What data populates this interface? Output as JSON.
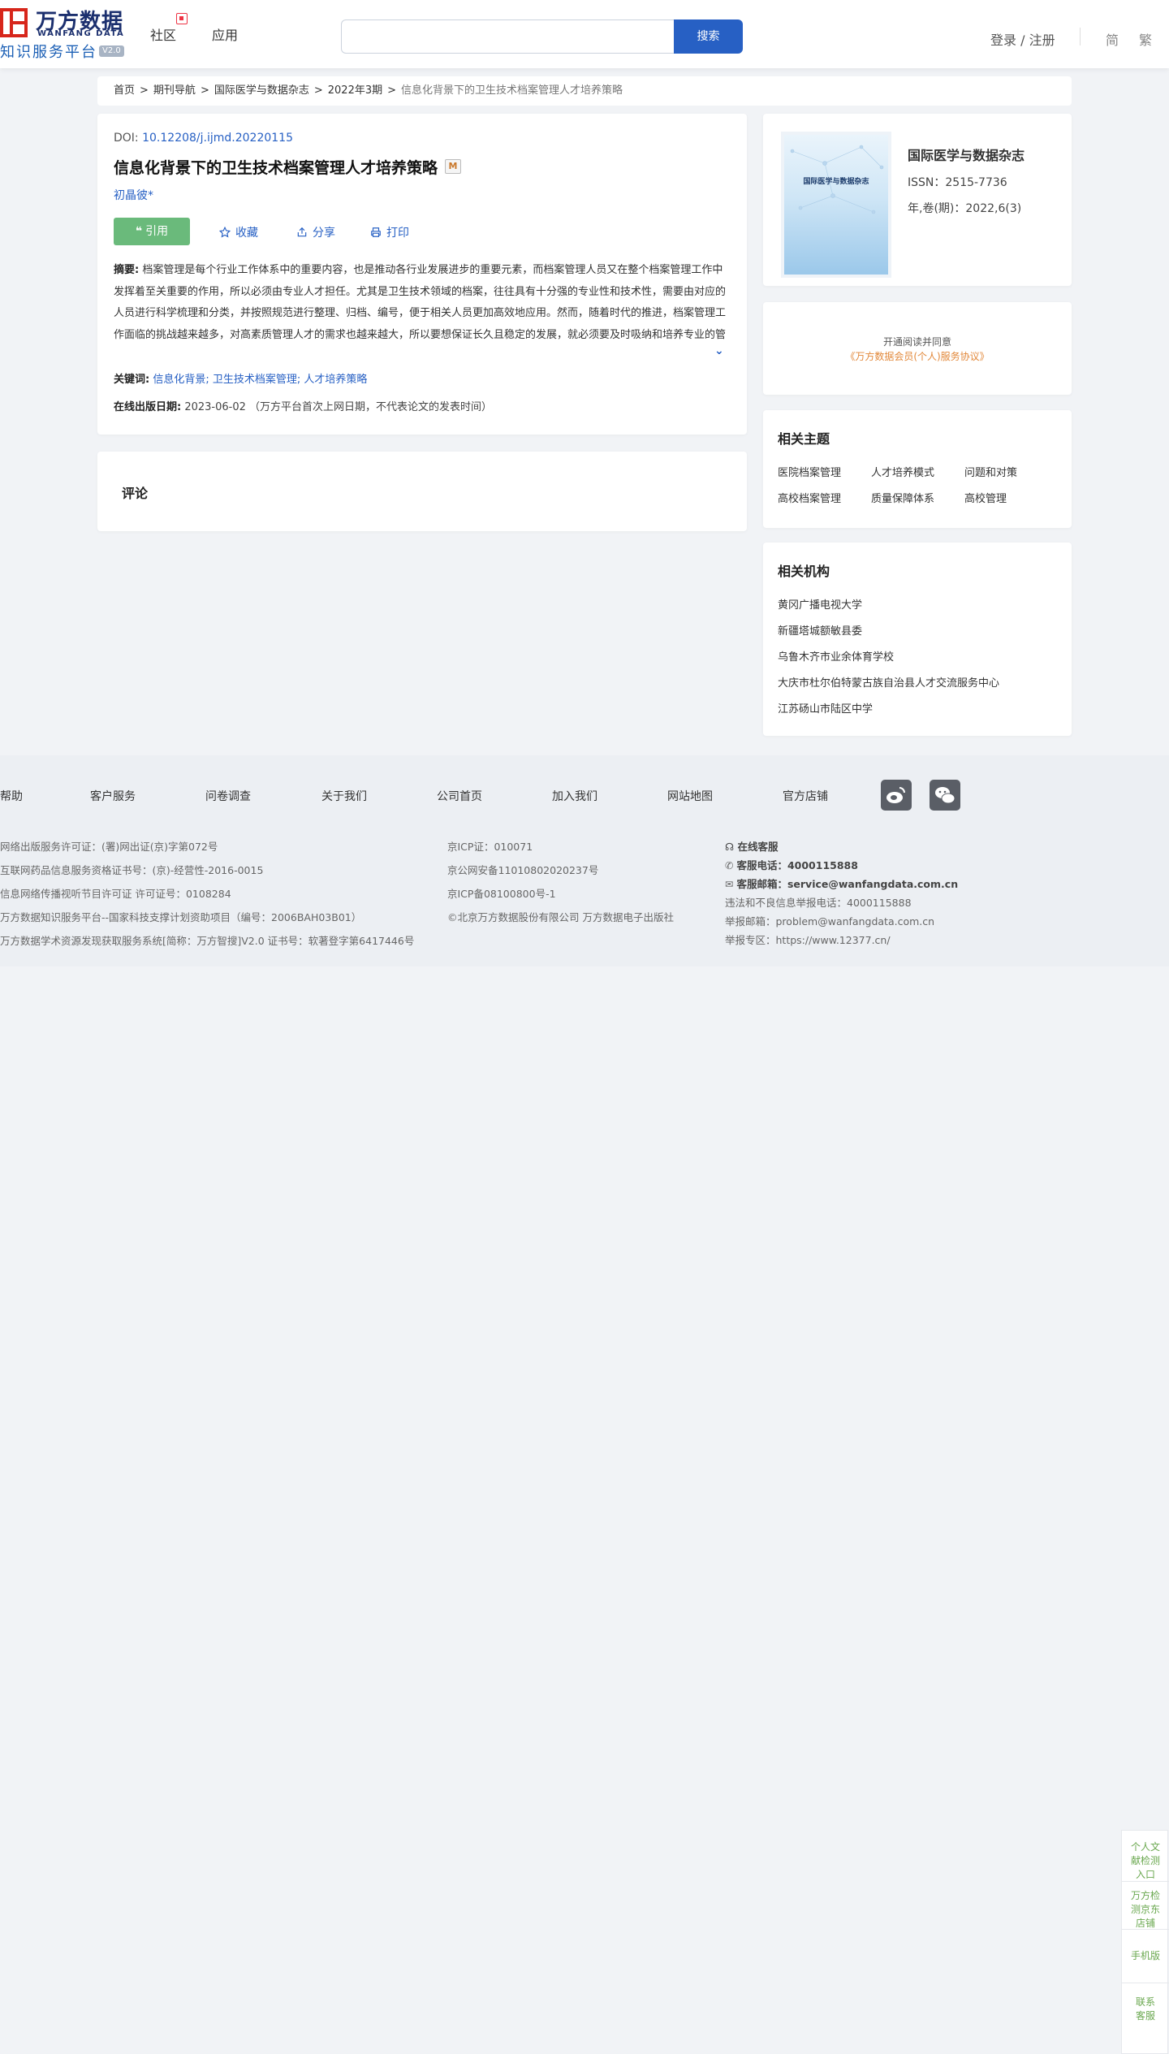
{
  "header": {
    "logo_cn": "万方数据",
    "logo_en": "WANFANG DATA",
    "platform": "知识服务平台",
    "version": "V2.0",
    "nav": [
      "社区",
      "应用"
    ],
    "search_placeholder": "",
    "search_button": "搜索",
    "login": "登录 / 注册",
    "lang_simplified": "简",
    "lang_traditional": "繁"
  },
  "breadcrumb": {
    "items": [
      "首页",
      "期刊导航",
      "国际医学与数据杂志",
      "2022年3期"
    ],
    "current": "信息化背景下的卫生技术档案管理人才培养策略",
    "separator": ">"
  },
  "article": {
    "doi_label": "DOI:",
    "doi": "10.12208/j.ijmd.20220115",
    "title": "信息化背景下的卫生技术档案管理人才培养策略",
    "badge": "M",
    "author": "初晶彼*",
    "cite_label": "引用",
    "actions": [
      "收藏",
      "分享",
      "打印"
    ],
    "abstract_label": "摘要:",
    "abstract": "档案管理是每个行业工作体系中的重要内容，也是推动各行业发展进步的重要元素，而档案管理人员又在整个档案管理工作中发挥着至关重要的作用，所以必须由专业人才担任。尤其是卫生技术领域的档案，往往具有十分强的专业性和技术性，需要由对应的人员进行科学梳理和分类，并按照规范进行整理、归档、编号，便于相关人员更加高效地应用。然而，随着时代的推进，档案管理工作面临的挑战越来越多，对高素质管理人才的需求也越来越大，所以要想保证长久且稳定的发展，就必须要及时吸纳和培养专业的管理人才，确保相关工作顺利推进。鉴于此，本文基于信息化背景，以卫生技术档...",
    "keywords_label": "关键词:",
    "keywords": [
      "信息化背景;",
      "卫生技术档案管理;",
      "人才培养策略"
    ],
    "pubdate_label": "在线出版日期:",
    "pubdate": "2023-06-02",
    "pubdate_note": "（万方平台首次上网日期，不代表论文的发表时间）"
  },
  "comment": {
    "title": "评论"
  },
  "journal": {
    "cover_title": "国际医学与数据杂志",
    "name": "国际医学与数据杂志",
    "issn": "ISSN：2515-7736",
    "volume": "年,卷(期)：2022,6(3)"
  },
  "read": {
    "line1": "开通阅读并同意",
    "line2": "《万方数据会员(个人)服务协议》"
  },
  "topics": {
    "title": "相关主题",
    "items": [
      "医院档案管理",
      "人才培养模式",
      "问题和对策",
      "高校档案管理",
      "质量保障体系",
      "高校管理"
    ]
  },
  "orgs": {
    "title": "相关机构",
    "items": [
      "黄冈广播电视大学",
      "新疆塔城额敏县委",
      "乌鲁木齐市业余体育学校",
      "大庆市杜尔伯特蒙古族自治县人才交流服务中心",
      "江苏砀山市陆区中学"
    ]
  },
  "footer": {
    "links": [
      "帮助",
      "客户服务",
      "问卷调查",
      "关于我们",
      "公司首页",
      "加入我们",
      "网站地图",
      "官方店铺"
    ],
    "col1": [
      "网络出版服务许可证：(署)网出证(京)字第072号",
      "互联网药品信息服务资格证书号：(京)-经营性-2016-0015",
      "信息网络传播视听节目许可证 许可证号：0108284",
      "万方数据知识服务平台--国家科技支撑计划资助项目（编号：2006BAH03B01）",
      "万方数据学术资源发现获取服务系统[简称：万方智搜]V2.0 证书号：软著登字第6417446号"
    ],
    "col2": [
      "京ICP证：010071",
      "京公网安备11010802020237号",
      "京ICP备08100800号-1",
      "©北京万方数据股份有限公司 万方数据电子出版社"
    ],
    "online_service": "在线客服",
    "phone_label": "客服电话：",
    "phone": "4000115888",
    "email_label": "客服邮箱：",
    "email": "service@wanfangdata.com.cn",
    "report_phone": "违法和不良信息举报电话：4000115888",
    "report_email": "举报邮箱：problem@wanfangdata.com.cn",
    "report_zone": "举报专区：https://www.12377.cn/"
  },
  "side_float": [
    "个人文献检测入口",
    "万方检测京东店铺",
    "手机版",
    "联系客服"
  ]
}
